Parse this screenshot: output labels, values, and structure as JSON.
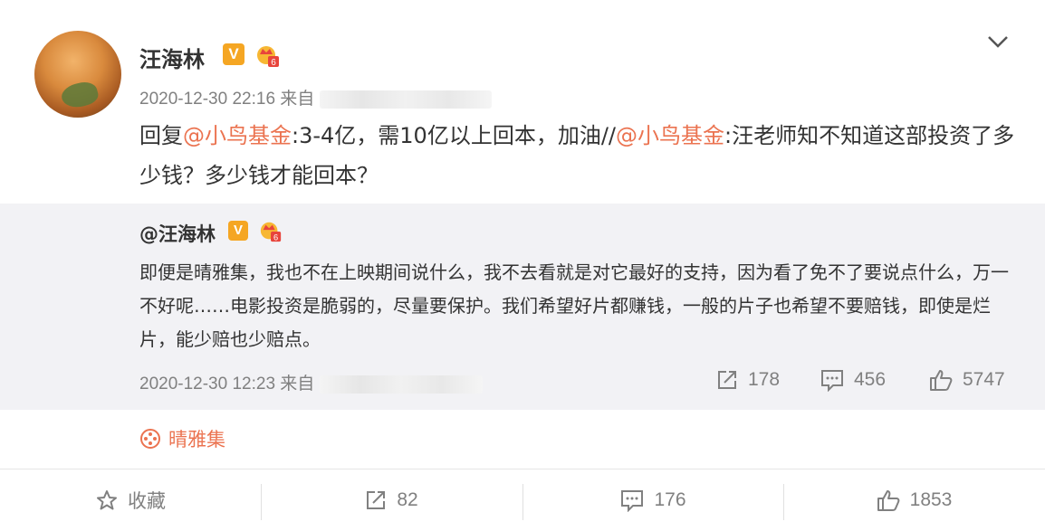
{
  "post": {
    "username": "汪海林",
    "vip_label": "V",
    "time": "2020-12-30 22:16",
    "source_prefix": "来自",
    "text_prefix": "回复",
    "mention1": "@小鸟基金",
    "text_mid": ":3-4亿，需10亿以上回本，加油//",
    "mention2": "@小鸟基金",
    "text_end": ":汪老师知不知道这部投资了多少钱？多少钱才能回本？"
  },
  "repost": {
    "username": "@汪海林",
    "vip_label": "V",
    "text": "即便是晴雅集，我也不在上映期间说什么，我不去看就是对它最好的支持，因为看了免不了要说点什么，万一不好呢……电影投资是脆弱的，尽量要保护。我们希望好片都赚钱，一般的片子也希望不要赔钱，即使是烂片，能少赔也少赔点。",
    "time": "2020-12-30 12:23",
    "source_prefix": "来自",
    "forward_count": "178",
    "comment_count": "456",
    "like_count": "5747"
  },
  "topic": {
    "label": "晴雅集",
    "icon": "film-reel-icon"
  },
  "footer": {
    "favorite_label": "收藏",
    "forward_count": "82",
    "comment_count": "176",
    "like_count": "1853"
  },
  "colors": {
    "accent": "#eb7350",
    "vip": "#f5a623",
    "muted": "#808080",
    "repost_bg": "#f2f2f5"
  }
}
